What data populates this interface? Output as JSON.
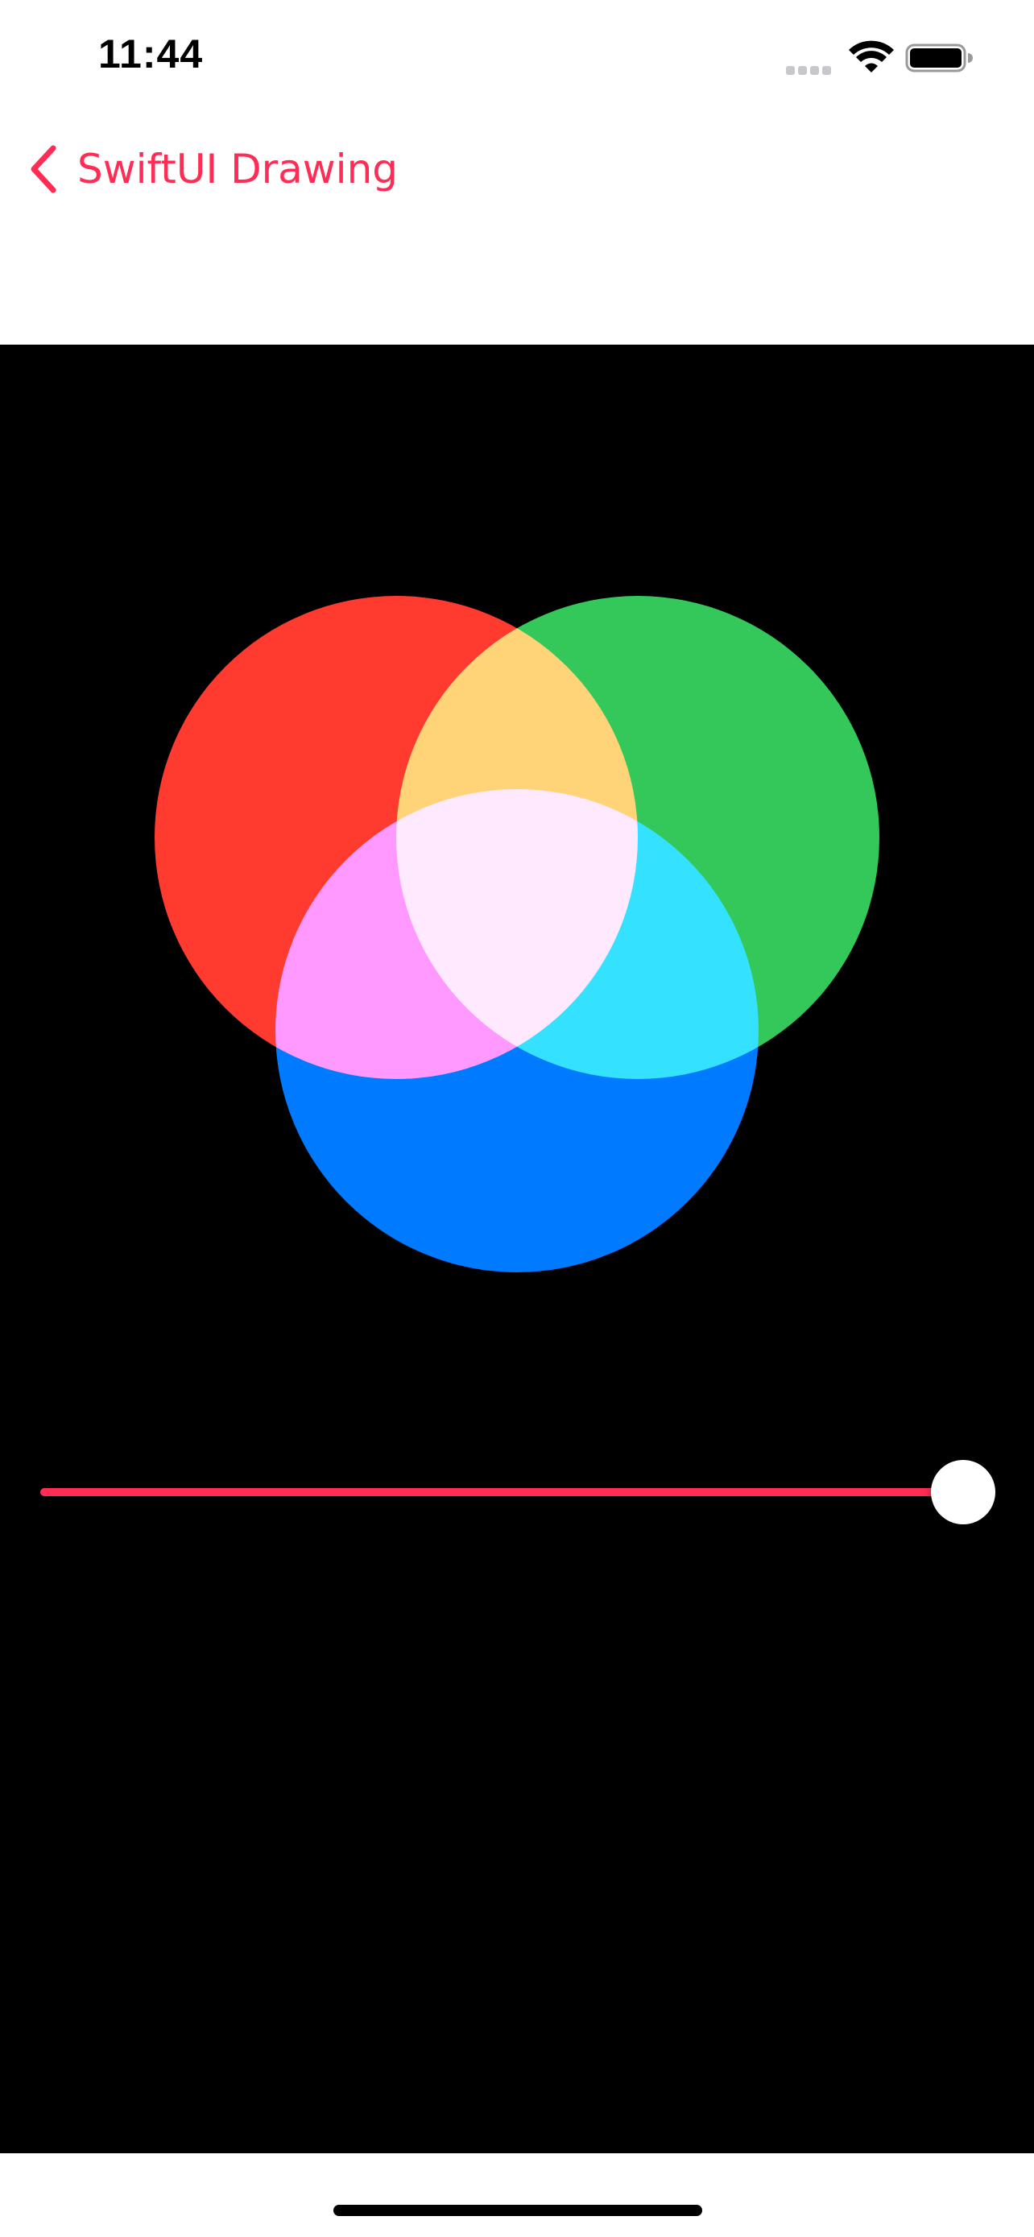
{
  "status_bar": {
    "time": "11:44"
  },
  "nav": {
    "back_label": "SwiftUI Drawing",
    "back_icon": "chevron-left-icon"
  },
  "venn": {
    "background": "#000000",
    "circles": [
      {
        "name": "red",
        "color": "#ff3b30"
      },
      {
        "name": "green",
        "color": "#34c759"
      },
      {
        "name": "blue",
        "color": "#007aff"
      }
    ]
  },
  "slider": {
    "value": 1.0,
    "accent": "#ff2d55"
  },
  "colors": {
    "accent": "#ff2d55"
  }
}
